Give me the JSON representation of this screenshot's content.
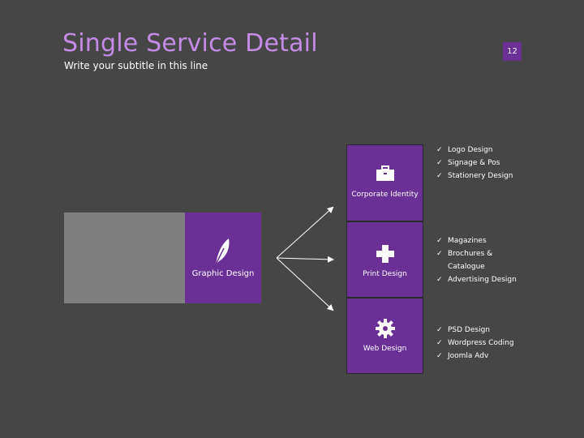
{
  "header": {
    "title": "Single Service Detail",
    "subtitle": "Write your subtitle in this line",
    "page_number": "12"
  },
  "colors": {
    "background": "#464646",
    "accent": "#6a3095",
    "title": "#c58be6",
    "placeholder": "#7f7f7f"
  },
  "main_service": {
    "label": "Graphic Design",
    "icon": "feather-icon"
  },
  "services": [
    {
      "label": "Corporate Identity",
      "icon": "briefcase-icon",
      "items": [
        "Logo Design",
        "Signage & Pos",
        "Stationery Design"
      ]
    },
    {
      "label": "Print Design",
      "icon": "puzzle-icon",
      "items": [
        "Magazines",
        "Brochures &",
        "Catalogue",
        "Advertising Design"
      ]
    },
    {
      "label": "Web Design",
      "icon": "gear-icon",
      "items": [
        "PSD Design",
        "Wordpress Coding",
        "Joomla Adv"
      ]
    }
  ]
}
